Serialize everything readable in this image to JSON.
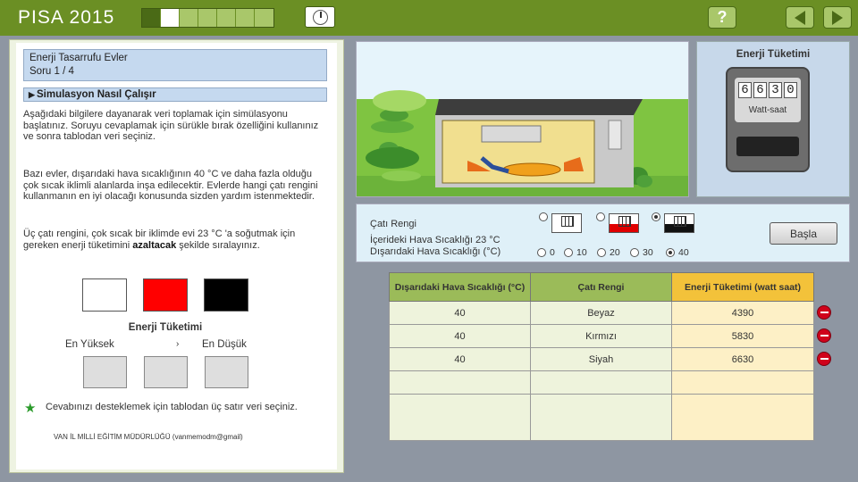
{
  "header": {
    "title": "PISA 2015",
    "progress_total": 7,
    "progress_done": 1,
    "progress_current": 2,
    "help_label": "?"
  },
  "question": {
    "unit_title": "Enerji Tasarrufu Evler",
    "item": "Soru 1 / 4",
    "howto": "Simulasyon Nasıl Çalışır",
    "intro": "Aşağıdaki bilgilere dayanarak veri toplamak için simülasyonu başlatınız. Soruyu cevaplamak için sürükle bırak özelliğini kullanınız ve sonra tablodan veri seçiniz.",
    "context": "Bazı evler, dışarıdaki hava sıcaklığının 40 °C ve daha fazla olduğu çok sıcak iklimli alanlarda inşa edilecektir. Evlerde hangi çatı rengini kullanmanın en iyi olacağı konusunda sizden yardım istenmektedir.",
    "task_prefix": "Üç çatı rengini, çok sıcak bir iklimde evi 23 °C 'a soğutmak için gereken enerji tüketimini ",
    "task_bold": "azaltacak",
    "task_suffix": " şekilde sıralayınız.",
    "energy_heading": "Enerji Tüketimi",
    "highest": "En Yüksek",
    "arrow": "›",
    "lowest": "En Düşük",
    "support_text": "Cevabınızı desteklemek için tablodan üç satır veri seçiniz.",
    "footer": "VAN İL MİLLİ EĞİTİM MÜDÜRLÜĞÜ (vanmemodm@gmail)"
  },
  "colors": {
    "header_green": "#6b8f24",
    "table_green": "#9bbb59",
    "table_yellow": "#f3c23a",
    "swatch_white": "#ffffff",
    "swatch_red": "#ff0000",
    "swatch_black": "#000000"
  },
  "meter": {
    "title": "Enerji Tüketimi",
    "digits": [
      "6",
      "6",
      "3",
      "0"
    ],
    "unit": "Watt-saat"
  },
  "controls": {
    "roof_label": "Çatı Rengi",
    "roof_options": [
      "white",
      "red",
      "black"
    ],
    "roof_selected": "black",
    "inside_label": "İçerideki Hava Sıcaklığı 23 °C",
    "outside_label": "Dışarıdaki Hava Sıcaklığı (°C)",
    "temps": [
      "0",
      "10",
      "20",
      "30",
      "40"
    ],
    "temp_selected": "40",
    "start_label": "Başla"
  },
  "table": {
    "headers": [
      "Dışarıdaki Hava Sıcaklığı (°C)",
      "Çatı Rengi",
      "Enerji Tüketimi (watt saat)"
    ],
    "rows": [
      [
        "40",
        "Beyaz",
        "4390"
      ],
      [
        "40",
        "Kırmızı",
        "5830"
      ],
      [
        "40",
        "Siyah",
        "6630"
      ]
    ]
  },
  "icons": [
    "help-icon",
    "back-arrow-icon",
    "next-arrow-icon",
    "timer-icon",
    "star-icon",
    "delete-row-icon"
  ]
}
